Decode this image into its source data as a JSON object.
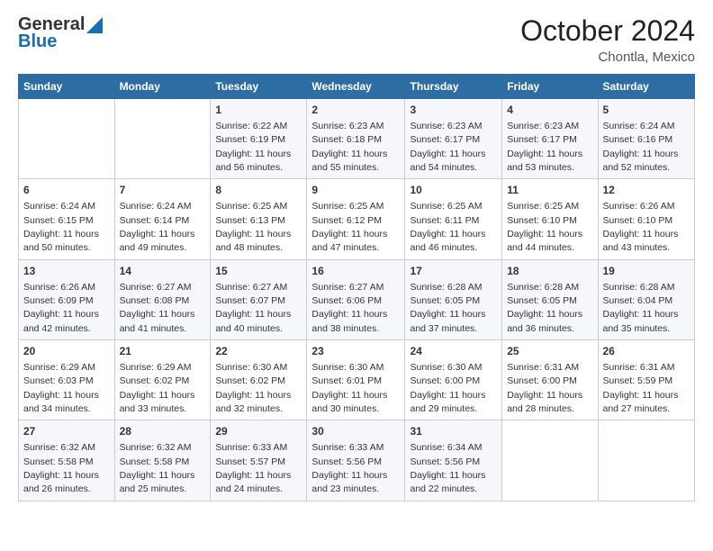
{
  "header": {
    "logo_general": "General",
    "logo_blue": "Blue",
    "month_title": "October 2024",
    "location": "Chontla, Mexico"
  },
  "days_of_week": [
    "Sunday",
    "Monday",
    "Tuesday",
    "Wednesday",
    "Thursday",
    "Friday",
    "Saturday"
  ],
  "weeks": [
    [
      {
        "day": "",
        "info": ""
      },
      {
        "day": "",
        "info": ""
      },
      {
        "day": "1",
        "info": "Sunrise: 6:22 AM\nSunset: 6:19 PM\nDaylight: 11 hours and 56 minutes."
      },
      {
        "day": "2",
        "info": "Sunrise: 6:23 AM\nSunset: 6:18 PM\nDaylight: 11 hours and 55 minutes."
      },
      {
        "day": "3",
        "info": "Sunrise: 6:23 AM\nSunset: 6:17 PM\nDaylight: 11 hours and 54 minutes."
      },
      {
        "day": "4",
        "info": "Sunrise: 6:23 AM\nSunset: 6:17 PM\nDaylight: 11 hours and 53 minutes."
      },
      {
        "day": "5",
        "info": "Sunrise: 6:24 AM\nSunset: 6:16 PM\nDaylight: 11 hours and 52 minutes."
      }
    ],
    [
      {
        "day": "6",
        "info": "Sunrise: 6:24 AM\nSunset: 6:15 PM\nDaylight: 11 hours and 50 minutes."
      },
      {
        "day": "7",
        "info": "Sunrise: 6:24 AM\nSunset: 6:14 PM\nDaylight: 11 hours and 49 minutes."
      },
      {
        "day": "8",
        "info": "Sunrise: 6:25 AM\nSunset: 6:13 PM\nDaylight: 11 hours and 48 minutes."
      },
      {
        "day": "9",
        "info": "Sunrise: 6:25 AM\nSunset: 6:12 PM\nDaylight: 11 hours and 47 minutes."
      },
      {
        "day": "10",
        "info": "Sunrise: 6:25 AM\nSunset: 6:11 PM\nDaylight: 11 hours and 46 minutes."
      },
      {
        "day": "11",
        "info": "Sunrise: 6:25 AM\nSunset: 6:10 PM\nDaylight: 11 hours and 44 minutes."
      },
      {
        "day": "12",
        "info": "Sunrise: 6:26 AM\nSunset: 6:10 PM\nDaylight: 11 hours and 43 minutes."
      }
    ],
    [
      {
        "day": "13",
        "info": "Sunrise: 6:26 AM\nSunset: 6:09 PM\nDaylight: 11 hours and 42 minutes."
      },
      {
        "day": "14",
        "info": "Sunrise: 6:27 AM\nSunset: 6:08 PM\nDaylight: 11 hours and 41 minutes."
      },
      {
        "day": "15",
        "info": "Sunrise: 6:27 AM\nSunset: 6:07 PM\nDaylight: 11 hours and 40 minutes."
      },
      {
        "day": "16",
        "info": "Sunrise: 6:27 AM\nSunset: 6:06 PM\nDaylight: 11 hours and 38 minutes."
      },
      {
        "day": "17",
        "info": "Sunrise: 6:28 AM\nSunset: 6:05 PM\nDaylight: 11 hours and 37 minutes."
      },
      {
        "day": "18",
        "info": "Sunrise: 6:28 AM\nSunset: 6:05 PM\nDaylight: 11 hours and 36 minutes."
      },
      {
        "day": "19",
        "info": "Sunrise: 6:28 AM\nSunset: 6:04 PM\nDaylight: 11 hours and 35 minutes."
      }
    ],
    [
      {
        "day": "20",
        "info": "Sunrise: 6:29 AM\nSunset: 6:03 PM\nDaylight: 11 hours and 34 minutes."
      },
      {
        "day": "21",
        "info": "Sunrise: 6:29 AM\nSunset: 6:02 PM\nDaylight: 11 hours and 33 minutes."
      },
      {
        "day": "22",
        "info": "Sunrise: 6:30 AM\nSunset: 6:02 PM\nDaylight: 11 hours and 32 minutes."
      },
      {
        "day": "23",
        "info": "Sunrise: 6:30 AM\nSunset: 6:01 PM\nDaylight: 11 hours and 30 minutes."
      },
      {
        "day": "24",
        "info": "Sunrise: 6:30 AM\nSunset: 6:00 PM\nDaylight: 11 hours and 29 minutes."
      },
      {
        "day": "25",
        "info": "Sunrise: 6:31 AM\nSunset: 6:00 PM\nDaylight: 11 hours and 28 minutes."
      },
      {
        "day": "26",
        "info": "Sunrise: 6:31 AM\nSunset: 5:59 PM\nDaylight: 11 hours and 27 minutes."
      }
    ],
    [
      {
        "day": "27",
        "info": "Sunrise: 6:32 AM\nSunset: 5:58 PM\nDaylight: 11 hours and 26 minutes."
      },
      {
        "day": "28",
        "info": "Sunrise: 6:32 AM\nSunset: 5:58 PM\nDaylight: 11 hours and 25 minutes."
      },
      {
        "day": "29",
        "info": "Sunrise: 6:33 AM\nSunset: 5:57 PM\nDaylight: 11 hours and 24 minutes."
      },
      {
        "day": "30",
        "info": "Sunrise: 6:33 AM\nSunset: 5:56 PM\nDaylight: 11 hours and 23 minutes."
      },
      {
        "day": "31",
        "info": "Sunrise: 6:34 AM\nSunset: 5:56 PM\nDaylight: 11 hours and 22 minutes."
      },
      {
        "day": "",
        "info": ""
      },
      {
        "day": "",
        "info": ""
      }
    ]
  ]
}
